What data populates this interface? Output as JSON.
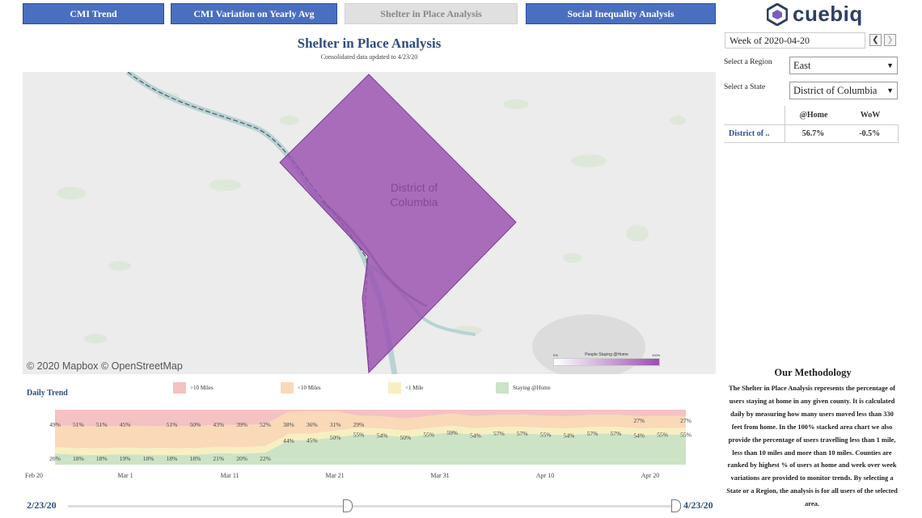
{
  "tabs": [
    {
      "label": "CMI Trend"
    },
    {
      "label": "CMI Variation on Yearly Avg"
    },
    {
      "label": "Shelter in Place Analysis"
    },
    {
      "label": "Social Inequality Analysis"
    }
  ],
  "brand": {
    "name": "cuebiq"
  },
  "header": {
    "title": "Shelter in Place Analysis",
    "subtitle": "Consolidated data updated to 4/23/20"
  },
  "map": {
    "region_label_line1": "District of",
    "region_label_line2": "Columbia",
    "attribution": "© 2020 Mapbox  © OpenStreetMap",
    "legend_title": "People Staying @Home",
    "legend_min": "0%",
    "legend_max": "100%",
    "fill_color": "#9a4fb0"
  },
  "filters": {
    "week": "Week of 2020-04-20",
    "region_label": "Select a Region",
    "region_value": "East",
    "state_label": "Select a State",
    "state_value": "District of Columbia"
  },
  "summary_table": {
    "headers": [
      "@Home",
      "WoW"
    ],
    "row_label": "District of ..",
    "home": "56.7%",
    "wow": "-0.5%"
  },
  "methodology": {
    "title": "Our Methodology",
    "text": "The Shelter in Place Analysis represents the percentage of users staying at home in any given county. It is calculated daily by measuring how many users moved less than 330 feet from home. In the 100% stacked area chart we also provide the percentage of users travelling less than 1 mile, less than 10 miles and more than 10 miles. Counties are ranked by highest % of users at home and week over week variations are provided to monitor trends. By selecting a State or a Region, the analysis is for all users of the selected area."
  },
  "daily_trend": {
    "title": "Daily Trend",
    "legend": [
      {
        "label": ">10 Miles",
        "color": "#f4c2c2"
      },
      {
        "label": "<10 Miles",
        "color": "#f9d9b8"
      },
      {
        "label": "<1 Mile",
        "color": "#f7efc2"
      },
      {
        "label": "Staying @Home",
        "color": "#cde3c5"
      }
    ]
  },
  "chart_data": {
    "type": "area",
    "title": "Daily Trend",
    "x_tick_labels": [
      "Feb 20",
      "Mar 1",
      "Mar 11",
      "Mar 21",
      "Mar 31",
      "Apr 10",
      "Apr 20"
    ],
    "date_range": [
      "2/23/20",
      "4/23/20"
    ],
    "ylim": [
      0,
      100
    ],
    "stacked_percent": true,
    "series": [
      {
        "name": "Staying @Home",
        "color": "#cde3c5"
      },
      {
        "name": "<1 Mile",
        "color": "#f7efc2"
      },
      {
        "name": "<10 Miles",
        "color": "#f9d9b8"
      },
      {
        "name": ">10 Miles",
        "color": "#f4c2c2"
      }
    ],
    "home_labels": [
      "20%",
      "18%",
      "18%",
      "19%",
      "18%",
      "18%",
      "18%",
      "21%",
      "20%",
      "22%",
      "44%",
      "45%",
      "50%",
      "55%",
      "54%",
      "50%",
      "55%",
      "59%",
      "54%",
      "57%",
      "57%",
      "55%",
      "54%",
      "57%",
      "57%",
      "54%",
      "55%",
      "55%"
    ],
    "lt10_labels": [
      "49%",
      "51%",
      "51%",
      "45%",
      "51%",
      "50%",
      "43%",
      "39%",
      "52%",
      "38%",
      "36%",
      "31%",
      "29%",
      "27%",
      "27%"
    ]
  },
  "slider": {
    "start": "2/23/20",
    "end": "4/23/20"
  }
}
